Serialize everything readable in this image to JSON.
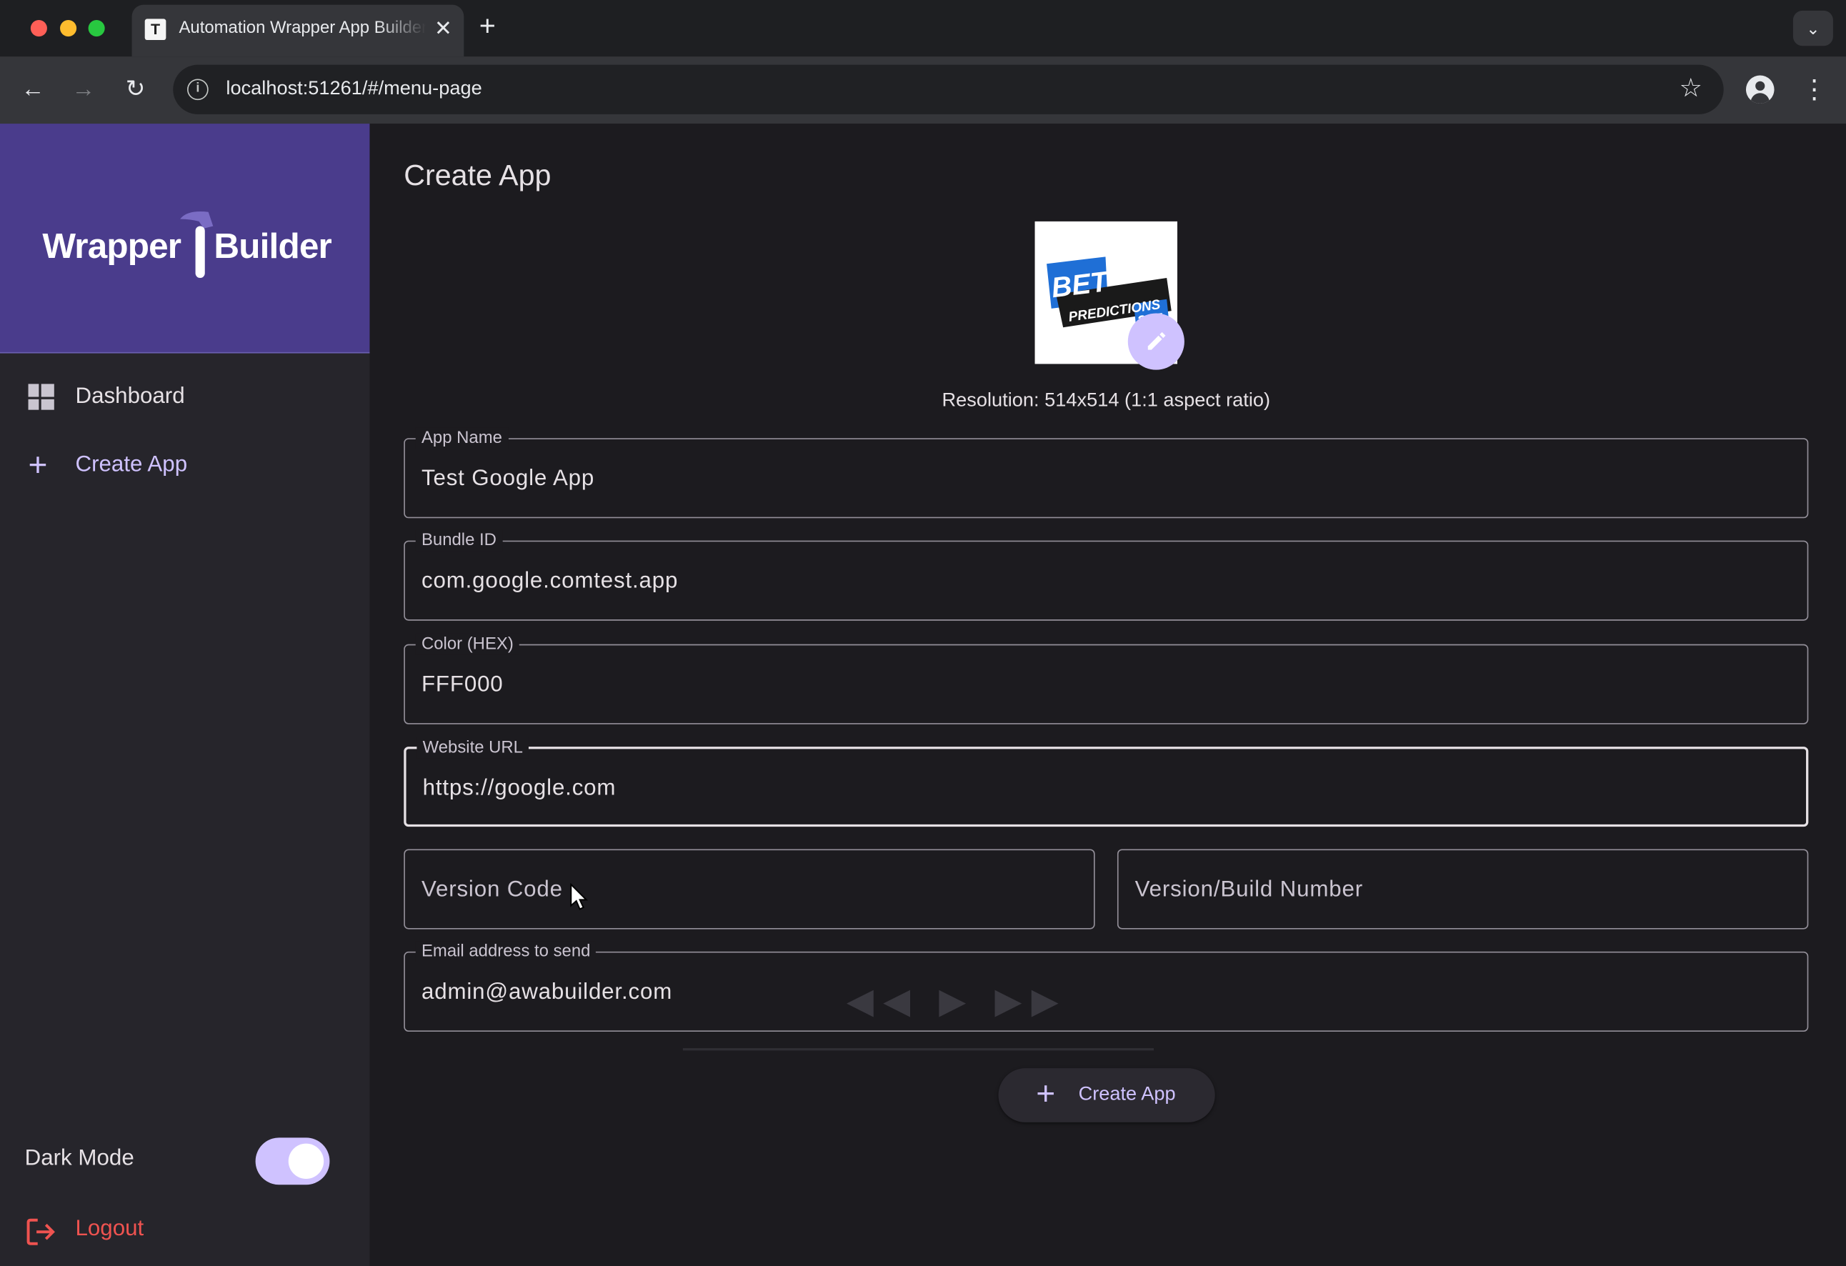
{
  "browser": {
    "tab_title": "Automation Wrapper App Builder",
    "tab_favicon": "T",
    "url": "localhost:51261/#/menu-page",
    "icons": [
      "back-arrow-icon",
      "forward-arrow-icon",
      "reload-icon",
      "info-icon",
      "star-icon",
      "profile-icon",
      "kebab-menu-icon",
      "close-icon",
      "plus-icon",
      "chevron-down-icon"
    ]
  },
  "sidebar": {
    "brand_left": "Wrapper",
    "brand_right": "Builder",
    "items": [
      {
        "label": "Dashboard",
        "icon": "dashboard-icon"
      },
      {
        "label": "Create App",
        "icon": "plus-icon",
        "active": true
      }
    ],
    "dark_mode_label": "Dark Mode",
    "dark_mode_on": true,
    "logout_label": "Logout",
    "accent_color": "#cfc2ff",
    "brand_color": "#4a3c8c",
    "logout_color": "#ef5350"
  },
  "main": {
    "title": "Create App",
    "logo": {
      "line1": "BET",
      "line2": "PREDICTIONS",
      "line3": "365"
    },
    "resolution": "Resolution: 514x514 (1:1 aspect ratio)",
    "fields": {
      "app_name": {
        "label": "App Name",
        "value": "Test Google App"
      },
      "bundle_id": {
        "label": "Bundle ID",
        "value": "com.google.comtest.app"
      },
      "color": {
        "label": "Color (HEX)",
        "value": "FFF000"
      },
      "website": {
        "label": "Website URL",
        "value": "https://google.com"
      },
      "version_code": {
        "placeholder": "Version Code"
      },
      "version_build": {
        "placeholder": "Version/Build Number"
      },
      "email": {
        "label": "Email address to send",
        "value": "admin@awabuilder.com"
      }
    },
    "create_button": "Create App"
  }
}
